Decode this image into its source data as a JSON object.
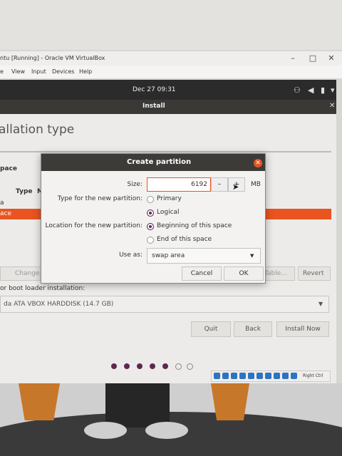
{
  "vbox": {
    "title": "ntu [Running] - Oracle VM VirtualBox",
    "menu": [
      "e",
      "View",
      "Input",
      "Devices",
      "Help"
    ],
    "status": {
      "host_key": "Right Ctrl"
    }
  },
  "gnome": {
    "clock": "Dec 27  09:31"
  },
  "installer": {
    "header_title": "Install",
    "page_heading": "allation type",
    "space_label": "pace",
    "columns": [
      "Type",
      "M"
    ],
    "row_a": "a",
    "row_selected": "ace",
    "change_label": "Change...",
    "table_label": "Table...",
    "revert_label": "Revert",
    "bootloader_label": "or boot loader installation:",
    "bootloader_value": "da ATA VBOX HARDDISK (14.7 GB)",
    "quit_label": "Quit",
    "back_label": "Back",
    "install_now_label": "Install Now",
    "progress": {
      "filled_dots": 5,
      "total_dots": 7
    }
  },
  "dialog": {
    "title": "Create partition",
    "size_label": "Size:",
    "size_value": "6192",
    "size_minus": "–",
    "size_plus": "+",
    "size_unit": "MB",
    "type_label": "Type for the new partition:",
    "type_options": [
      "Primary",
      "Logical"
    ],
    "type_selected": "Logical",
    "location_label": "Location for the new partition:",
    "location_options": [
      "Beginning of this space",
      "End of this space"
    ],
    "location_selected": "Beginning of this space",
    "use_as_label": "Use as:",
    "use_as_value": "swap area",
    "cancel_label": "Cancel",
    "ok_label": "OK"
  },
  "colors": {
    "accent": "#e95420",
    "aubergine": "#5e2750",
    "titlebar": "#3c3b38"
  }
}
